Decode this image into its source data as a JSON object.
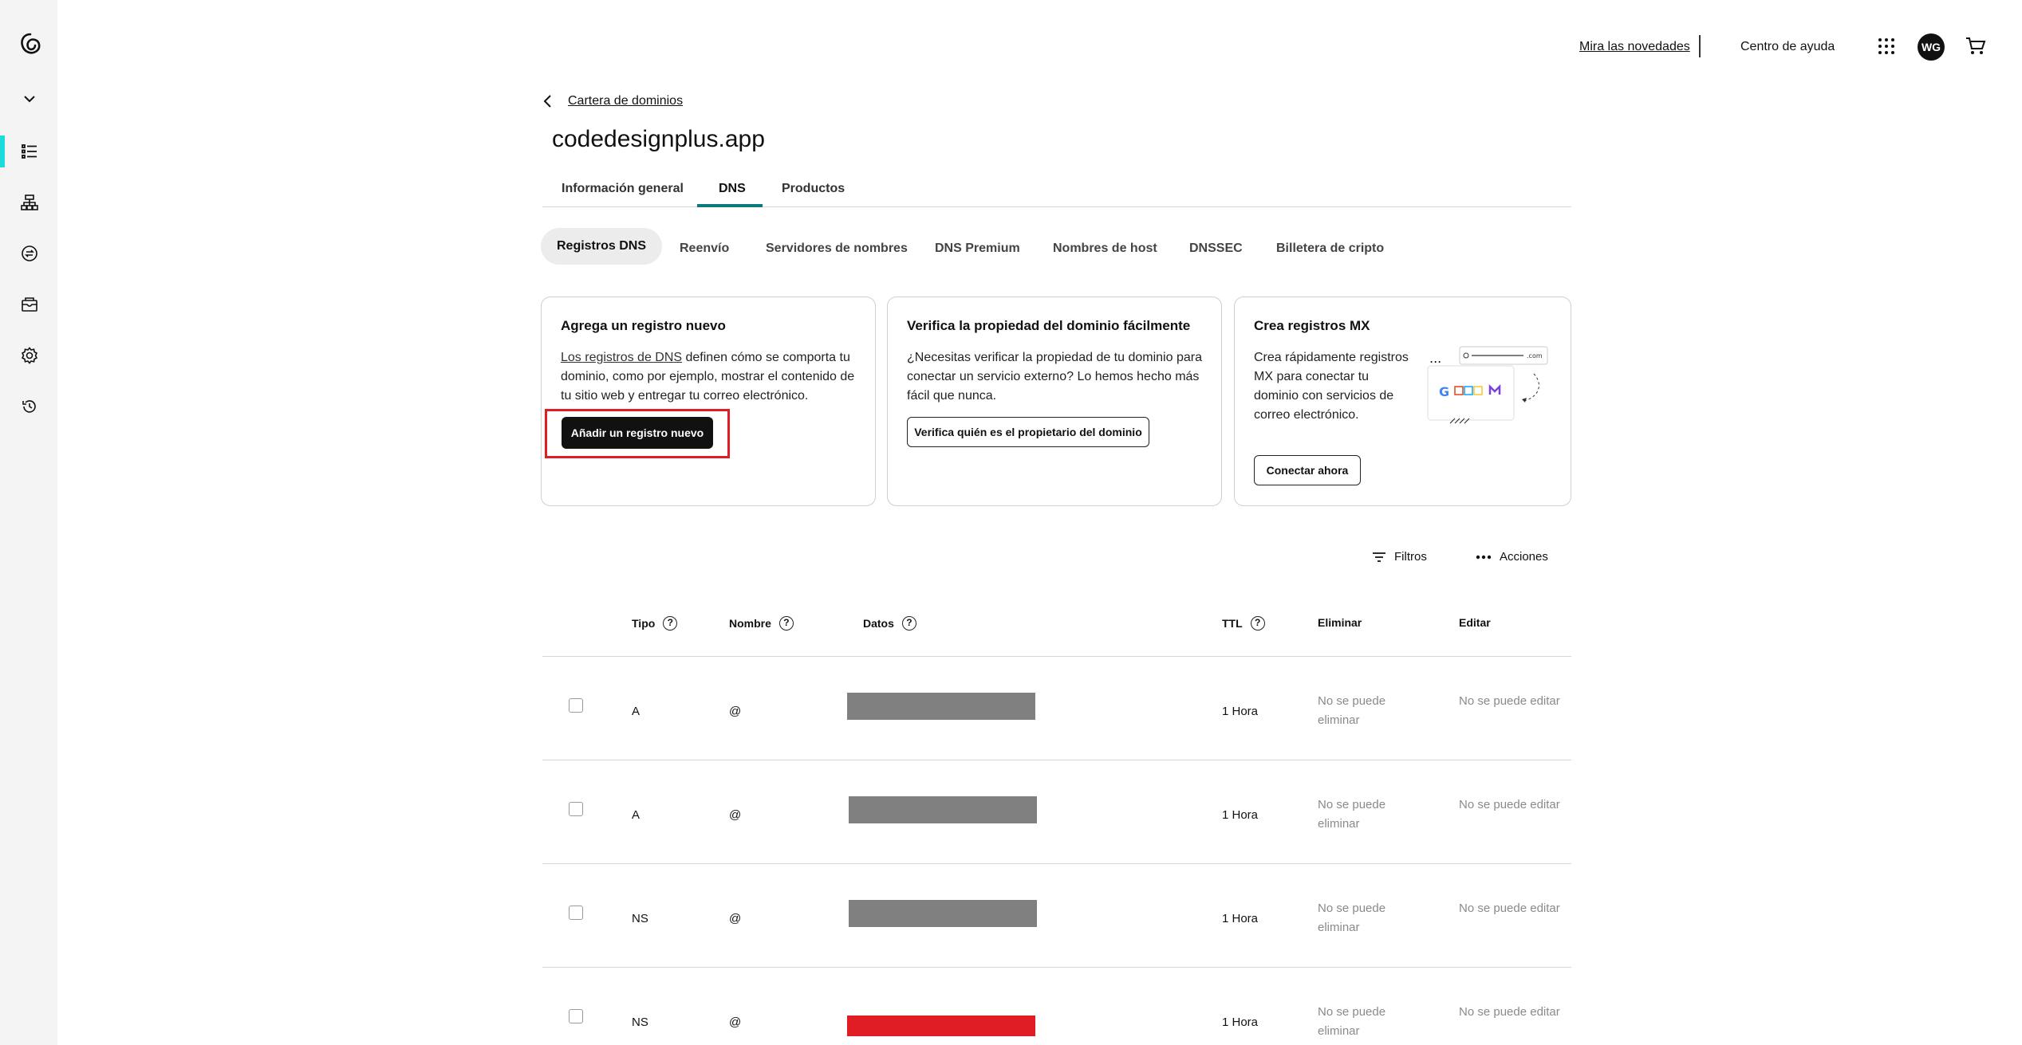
{
  "header": {
    "whats_new": "Mira las novedades",
    "help_center": "Centro de ayuda",
    "avatar_initials": "WG"
  },
  "breadcrumb": {
    "label": "Cartera de dominios"
  },
  "page_title": "codedesignplus.app",
  "tabs": [
    {
      "label": "Información general"
    },
    {
      "label": "DNS"
    },
    {
      "label": "Productos"
    }
  ],
  "subtabs": [
    {
      "label": "Registros DNS"
    },
    {
      "label": "Reenvío"
    },
    {
      "label": "Servidores de nombres"
    },
    {
      "label": "DNS Premium"
    },
    {
      "label": "Nombres de host"
    },
    {
      "label": "DNSSEC"
    },
    {
      "label": "Billetera de cripto"
    }
  ],
  "cards": {
    "add_record": {
      "title": "Agrega un registro nuevo",
      "link": "Los registros de DNS",
      "body_rest": " definen cómo se comporta tu dominio, como por ejemplo, mostrar el contenido de tu sitio web y entregar tu correo electrónico.",
      "button": "Añadir un registro nuevo"
    },
    "verify": {
      "title": "Verifica la propiedad del dominio fácilmente",
      "body": "¿Necesitas verificar la propiedad de tu dominio para conectar un servicio externo? Lo hemos hecho más fácil que nunca.",
      "button": "Verifica quién es el propietario del dominio"
    },
    "mx": {
      "title": "Crea registros MX",
      "body": "Crea rápidamente registros MX para conectar tu dominio con servicios de correo electrónico.",
      "button": "Conectar ahora",
      "illustration_domain": ".com"
    }
  },
  "toolbar": {
    "filters": "Filtros",
    "actions": "Acciones"
  },
  "table": {
    "headers": {
      "type": "Tipo",
      "name": "Nombre",
      "data": "Datos",
      "ttl": "TTL",
      "delete": "Eliminar",
      "edit": "Editar",
      "help_glyph": "?"
    },
    "rows": [
      {
        "type": "A",
        "name": "@",
        "ttl": "1 Hora",
        "delete": "No se puede eliminar",
        "edit": "No se puede editar"
      },
      {
        "type": "A",
        "name": "@",
        "ttl": "1 Hora",
        "delete": "No se puede eliminar",
        "edit": "No se puede editar"
      },
      {
        "type": "NS",
        "name": "@",
        "ttl": "1 Hora",
        "delete": "No se puede eliminar",
        "edit": "No se puede editar"
      },
      {
        "type": "NS",
        "name": "@",
        "ttl": "1 Hora",
        "delete": "No se puede eliminar",
        "edit": "No se puede editar"
      }
    ]
  },
  "colors": {
    "accent": "#1bdbdb",
    "tab_underline": "#0a7a7a",
    "highlight": "#e01c24",
    "redaction_gray": "#808080"
  }
}
